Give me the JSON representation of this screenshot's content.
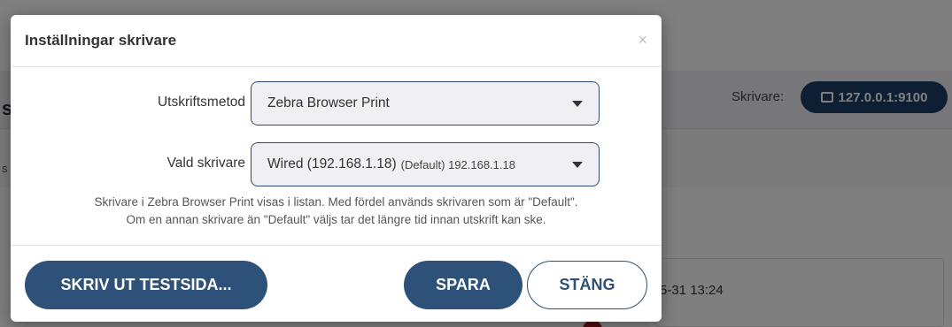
{
  "background": {
    "printer_label": "Skrivare:",
    "printer_value": "127.0.0.1:9100",
    "time_text": "5-31 13:24",
    "left_fragment": "s",
    "left_fragment2": "s"
  },
  "modal": {
    "title": "Inställningar skrivare",
    "close_glyph": "×",
    "print_method": {
      "label": "Utskriftsmetod",
      "value": "Zebra Browser Print"
    },
    "printer": {
      "label": "Vald skrivare",
      "value": "Wired (192.168.1.18)",
      "detail": "(Default) 192.168.1.18"
    },
    "help_line1": "Skrivare i Zebra Browser Print visas i listan. Med fördel används skrivaren som är \"Default\".",
    "help_line2": "Om en annan skrivare än \"Default\" väljs tar det längre tid innan utskrift kan ske.",
    "buttons": {
      "test": "SKRIV UT TESTSIDA...",
      "save": "SPARA",
      "close": "STÄNG"
    }
  },
  "colors": {
    "primary": "#2d5178",
    "printer_button": "#1d3f66",
    "overlay": "rgba(0,0,0,0.5)"
  }
}
